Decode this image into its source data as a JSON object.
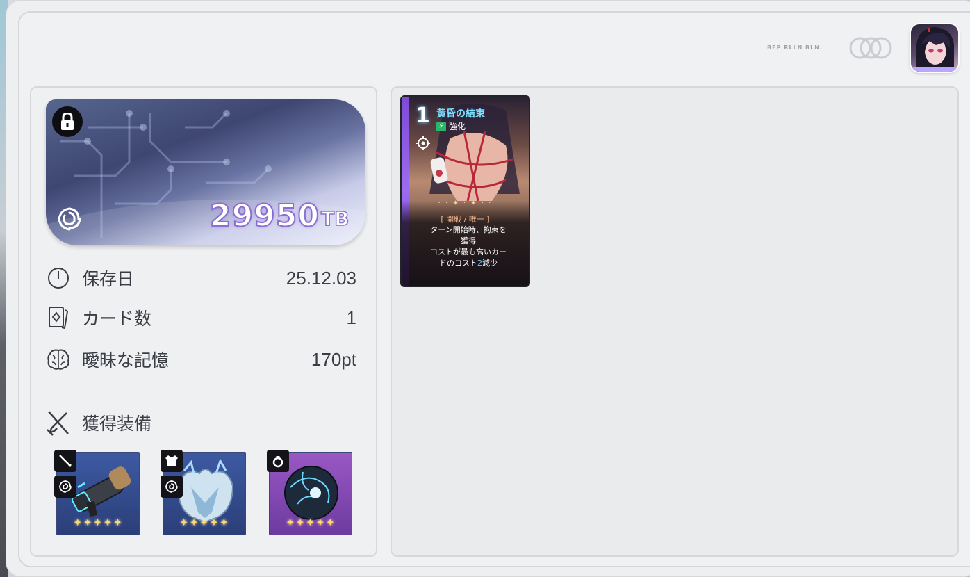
{
  "header": {
    "small_text": "BFP RLLN BLN."
  },
  "save": {
    "tb_value": "29950",
    "tb_unit": "TB"
  },
  "stats": [
    {
      "label": "保存日",
      "value": "25.12.03"
    },
    {
      "label": "カード数",
      "value": "1"
    },
    {
      "label": "曖昧な記憶",
      "value": "170pt"
    }
  ],
  "equipment": {
    "title": "獲得装備",
    "items": [
      {
        "name": "weapon",
        "stars": "✦✦✦✦✦",
        "rarity_color": "#3d5aa2"
      },
      {
        "name": "armor",
        "stars": "✦✦✦✦✦",
        "rarity_color": "#3d5aa2"
      },
      {
        "name": "ring",
        "stars": "✦✦✦✦✦",
        "rarity_color": "#9a58c4"
      }
    ]
  },
  "card": {
    "cost": "1",
    "name": "黄昏の結束",
    "type": "強化",
    "sparkles": "· · ✦ · ✦ · ·",
    "tag": "[ 開戦 / 唯一 ]",
    "desc_line1": "ターン開始時、拘束を",
    "desc_line2": "獲得",
    "desc_line3": "コストが最も高いカー",
    "desc_line4a": "ドのコスト",
    "desc_line4b": "2",
    "desc_line4c": "減少"
  },
  "colors": {
    "accent_purple": "#8a6fd0",
    "card_name": "#7fe0ff",
    "star_gold": "#ffd66a"
  }
}
